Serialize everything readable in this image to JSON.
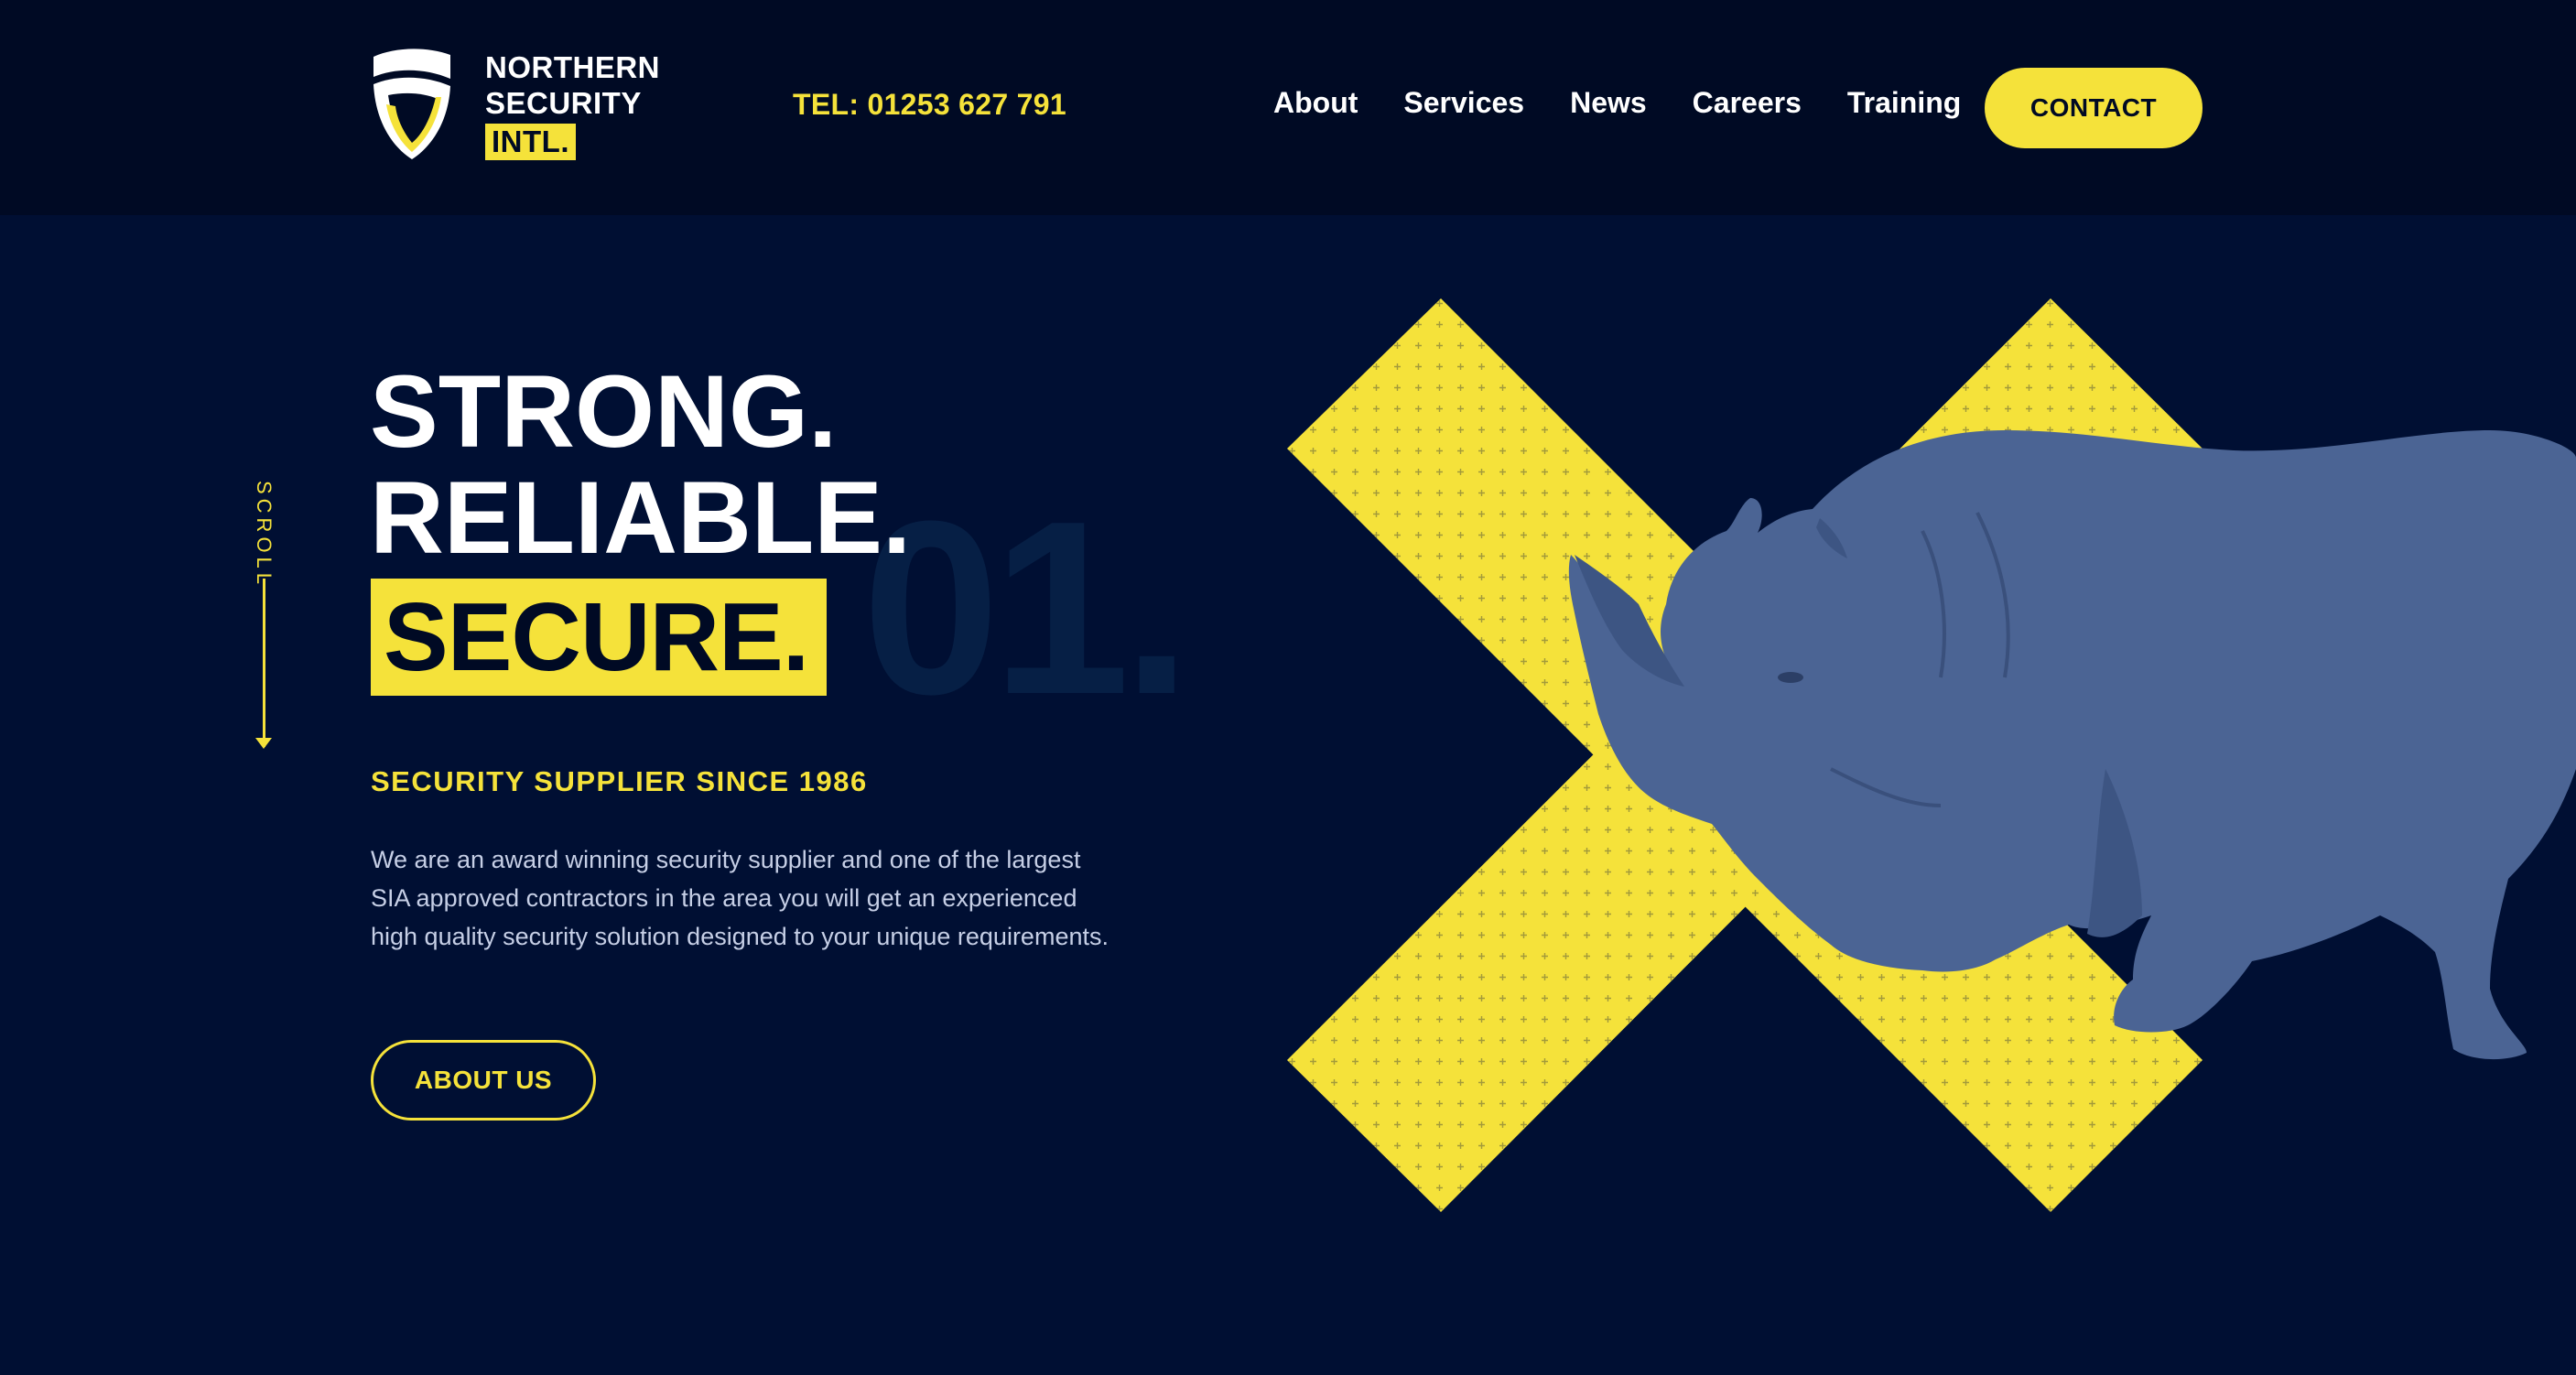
{
  "header": {
    "logo": {
      "line1": "NORTHERN",
      "line2": "SECURITY",
      "badge": "INTL.",
      "icon": "shield-logo-icon",
      "accent": "#f5e23a"
    },
    "tel": "TEL: 01253 627 791",
    "nav": [
      "About",
      "Services",
      "News",
      "Careers",
      "Training"
    ],
    "contact_label": "CONTACT"
  },
  "scroll": {
    "label": "SCROLL",
    "icon": "arrow-down-icon"
  },
  "hero": {
    "line1": "STRONG.",
    "line2": "RELIABLE.",
    "line3": "SECURE.",
    "number": "01.",
    "subtitle": "SECURITY SUPPLIER SINCE 1986",
    "description": "We are an award winning security supplier and one of the largest SIA approved contractors in the area you will get an experienced high quality security solution designed to your unique requirements.",
    "cta_label": "ABOUT US",
    "graphic": {
      "shape": "x-cross-icon",
      "animal": "rhino-illustration",
      "cross_color": "#f5e23a",
      "animal_color": "#4b6494"
    }
  },
  "colors": {
    "background": "#000f33",
    "header_background": "#000a24",
    "accent": "#f5e23a",
    "text": "#ffffff"
  }
}
